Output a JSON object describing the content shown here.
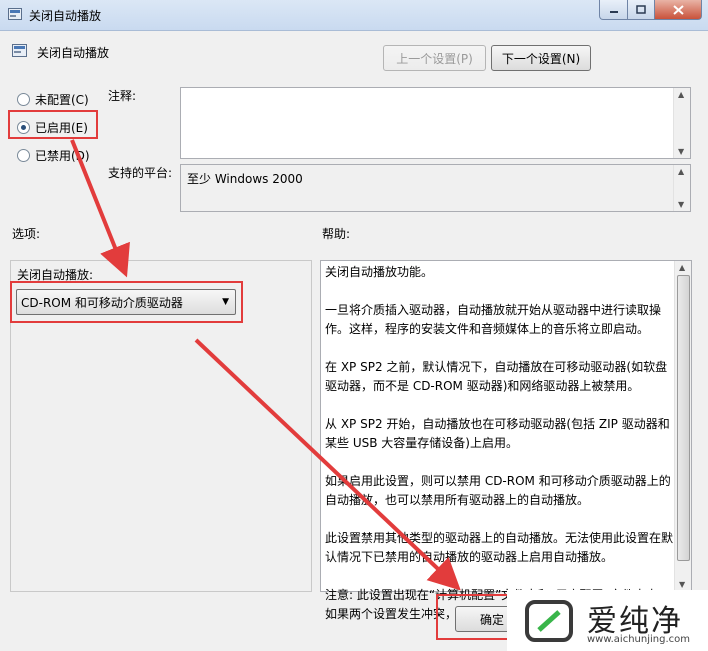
{
  "window": {
    "title": "关闭自动播放"
  },
  "header": {
    "title": "关闭自动播放"
  },
  "nav": {
    "prev_label": "上一个设置(P)",
    "next_label": "下一个设置(N)"
  },
  "state": {
    "not_configured": "未配置(C)",
    "enabled": "已启用(E)",
    "disabled": "已禁用(D)",
    "selected": "enabled"
  },
  "comment": {
    "label": "注释:",
    "value": ""
  },
  "platform": {
    "label": "支持的平台:",
    "value": "至少 Windows 2000"
  },
  "options": {
    "section_label": "选项:",
    "field_label": "关闭自动播放:",
    "selected_value": "CD-ROM 和可移动介质驱动器"
  },
  "help": {
    "section_label": "帮助:",
    "paragraphs": [
      "关闭自动播放功能。",
      "一旦将介质插入驱动器，自动播放就开始从驱动器中进行读取操作。这样，程序的安装文件和音频媒体上的音乐将立即启动。",
      "在 XP SP2 之前，默认情况下，自动播放在可移动驱动器(如软盘驱动器，而不是 CD-ROM 驱动器)和网络驱动器上被禁用。",
      "从 XP SP2 开始，自动播放也在可移动驱动器(包括 ZIP 驱动器和某些 USB 大容量存储设备)上启用。",
      "如果启用此设置，则可以禁用 CD-ROM 和可移动介质驱动器上的自动播放，也可以禁用所有驱动器上的自动播放。",
      "此设置禁用其他类型的驱动器上的自动播放。无法使用此设置在默认情况下已禁用的自动播放的驱动器上启用自动播放。",
      "注意: 此设置出现在“计算机配置”文件夹和“用户配置”文件夹中。如果两个设置发生冲突，则“计算机配置”中的设置优先于“"
    ]
  },
  "footer": {
    "ok_label": "确定"
  },
  "watermark": {
    "brand": "爱纯净",
    "url": "www.aichunjing.com"
  },
  "colors": {
    "annotation": "#e23c3c",
    "accent": "#2a4f7a"
  }
}
